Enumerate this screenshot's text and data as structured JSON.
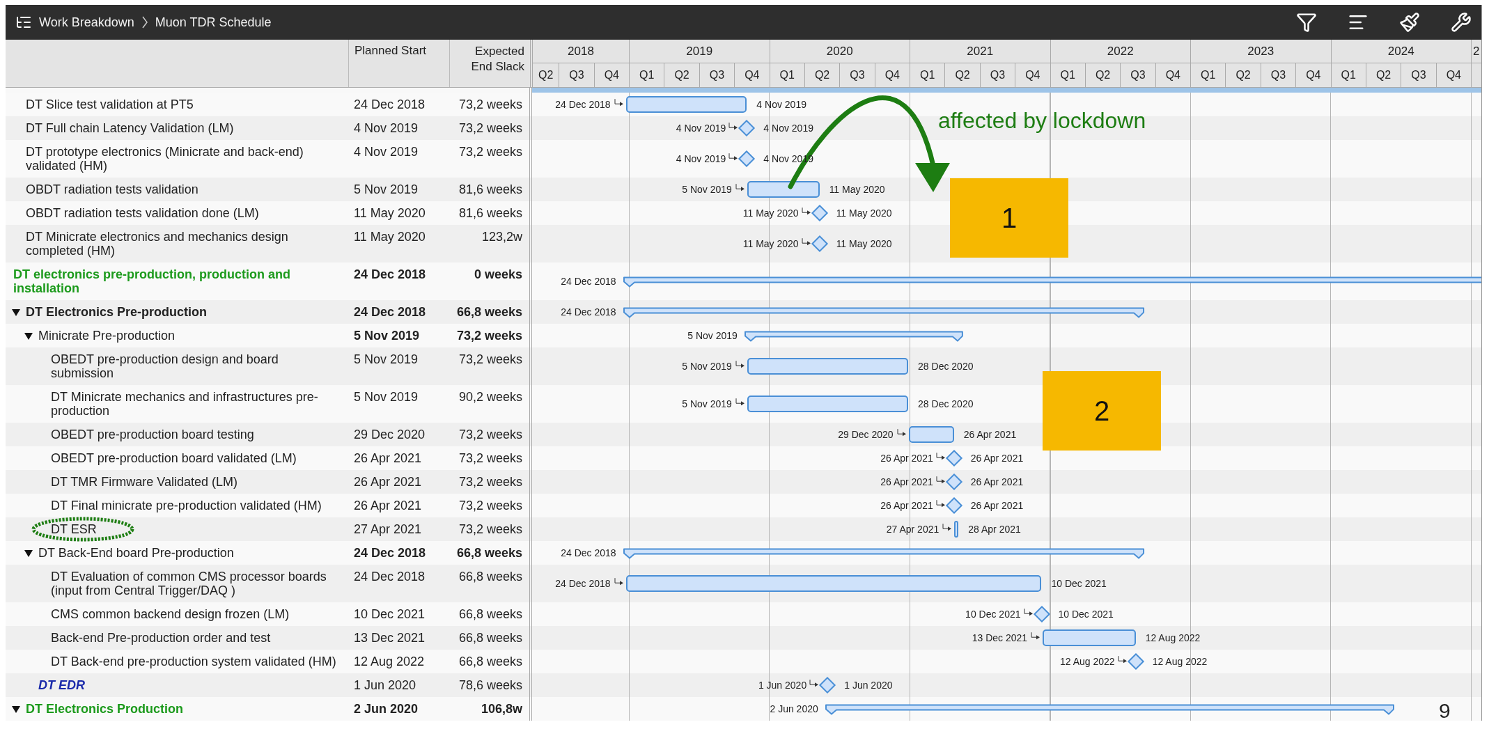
{
  "toolbar": {
    "breadcrumb": [
      "Work Breakdown",
      "Muon TDR Schedule"
    ]
  },
  "columns": {
    "planned_start": "Planned Start",
    "slack": "Expected End Slack"
  },
  "timeline": {
    "years": [
      {
        "label": "2018",
        "quarters": [
          "Q2",
          "Q3",
          "Q4"
        ]
      },
      {
        "label": "2019",
        "quarters": [
          "Q1",
          "Q2",
          "Q3",
          "Q4"
        ]
      },
      {
        "label": "2020",
        "quarters": [
          "Q1",
          "Q2",
          "Q3",
          "Q4"
        ]
      },
      {
        "label": "2021",
        "quarters": [
          "Q1",
          "Q2",
          "Q3",
          "Q4"
        ]
      },
      {
        "label": "2022",
        "quarters": [
          "Q1",
          "Q2",
          "Q3",
          "Q4"
        ]
      },
      {
        "label": "2023",
        "quarters": [
          "Q1",
          "Q2",
          "Q3",
          "Q4"
        ]
      },
      {
        "label": "2024",
        "quarters": [
          "Q1",
          "Q2",
          "Q3",
          "Q4"
        ]
      },
      {
        "label": "2"
      }
    ]
  },
  "rows": [
    {
      "name": "DT Slice test validation at PT5",
      "kind": "task",
      "start": "24 Dec 2018",
      "slack": "73,2 weeks",
      "bar": {
        "kind": "task",
        "start": "24 Dec 2018",
        "end": "4 Nov 2019"
      }
    },
    {
      "name": "DT Full chain Latency Validation (LM)",
      "kind": "task",
      "start": "4 Nov 2019",
      "slack": "73,2 weeks",
      "bar": {
        "kind": "milestone",
        "start": "4 Nov 2019",
        "end": "4 Nov 2019"
      }
    },
    {
      "name": "DT prototype electronics (Minicrate and back-end) validated (HM)",
      "kind": "task",
      "start": "4 Nov 2019",
      "slack": "73,2 weeks",
      "bar": {
        "kind": "milestone",
        "start": "4 Nov 2019",
        "end": "4 Nov 2019"
      }
    },
    {
      "name": "OBDT radiation tests validation",
      "kind": "task",
      "start": "5 Nov 2019",
      "slack": "81,6 weeks",
      "bar": {
        "kind": "task",
        "start": "5 Nov 2019",
        "end": "11 May 2020"
      }
    },
    {
      "name": "OBDT radiation tests validation done (LM)",
      "kind": "task",
      "start": "11 May 2020",
      "slack": "81,6 weeks",
      "bar": {
        "kind": "milestone",
        "start": "11 May 2020",
        "end": "11 May 2020"
      }
    },
    {
      "name": "DT Minicrate electronics and mechanics design completed (HM)",
      "kind": "task",
      "start": "11 May 2020",
      "slack": "123,2w",
      "bar": {
        "kind": "milestone",
        "start": "11 May 2020",
        "end": "11 May 2020"
      }
    },
    {
      "name": "DT electronics pre-production, production and installation",
      "kind": "summary",
      "color": "#1c9a1c",
      "start": "24 Dec 2018",
      "slack": "0 weeks",
      "bar": {
        "kind": "summary",
        "start": "24 Dec 2018"
      }
    },
    {
      "name": "DT Electronics Pre-production",
      "kind": "summary",
      "expanded": true,
      "start": "24 Dec 2018",
      "slack": "66,8 weeks",
      "bar": {
        "kind": "summary",
        "start": "24 Dec 2018"
      },
      "children": [
        {
          "name": "Minicrate Pre-production",
          "kind": "summary",
          "expanded": true,
          "start": "5 Nov 2019",
          "slack": "73,2 weeks",
          "bar": {
            "kind": "summary",
            "start": "5 Nov 2019"
          },
          "children": [
            {
              "name": "OBEDT pre-production design and board submission",
              "kind": "task",
              "start": "5 Nov 2019",
              "slack": "73,2 weeks",
              "bar": {
                "kind": "task",
                "start": "5 Nov 2019",
                "end": "28 Dec 2020"
              }
            },
            {
              "name": "DT Minicrate mechanics and infrastructures pre-production",
              "kind": "task",
              "start": "5 Nov 2019",
              "slack": "90,2 weeks",
              "bar": {
                "kind": "task",
                "start": "5 Nov 2019",
                "end": "28 Dec 2020"
              }
            },
            {
              "name": "OBEDT pre-production board testing",
              "kind": "task",
              "start": "29 Dec 2020",
              "slack": "73,2 weeks",
              "bar": {
                "kind": "task",
                "start": "29 Dec 2020",
                "end": "26 Apr 2021"
              }
            },
            {
              "name": "OBEDT pre-production board validated (LM)",
              "kind": "task",
              "start": "26 Apr 2021",
              "slack": "73,2 weeks",
              "bar": {
                "kind": "milestone",
                "start": "26 Apr 2021",
                "end": "26 Apr 2021"
              }
            },
            {
              "name": "DT TMR Firmware Validated (LM)",
              "kind": "task",
              "start": "26 Apr 2021",
              "slack": "73,2 weeks",
              "bar": {
                "kind": "milestone",
                "start": "26 Apr 2021",
                "end": "26 Apr 2021"
              }
            },
            {
              "name": "DT Final minicrate pre-production validated (HM)",
              "kind": "task",
              "start": "26 Apr 2021",
              "slack": "73,2 weeks",
              "bar": {
                "kind": "milestone",
                "start": "26 Apr 2021",
                "end": "26 Apr 2021"
              }
            },
            {
              "name": "DT ESR",
              "kind": "task",
              "start": "27 Apr 2021",
              "slack": "73,2 weeks",
              "bar": {
                "kind": "task",
                "start": "27 Apr 2021",
                "end": "28 Apr 2021"
              }
            }
          ]
        },
        {
          "name": "DT Back-End board Pre-production",
          "kind": "summary",
          "expanded": true,
          "start": "24 Dec 2018",
          "slack": "66,8 weeks",
          "bar": {
            "kind": "summary",
            "start": "24 Dec 2018"
          },
          "children": [
            {
              "name": "DT Evaluation of common CMS processor boards (input from Central Trigger/DAQ )",
              "kind": "task",
              "start": "24 Dec 2018",
              "slack": "66,8 weeks",
              "bar": {
                "kind": "task",
                "start": "24 Dec 2018",
                "end": "10 Dec 2021"
              }
            },
            {
              "name": "CMS common backend design frozen (LM)",
              "kind": "task",
              "start": "10 Dec 2021",
              "slack": "66,8 weeks",
              "bar": {
                "kind": "milestone",
                "start": "10 Dec 2021",
                "end": "10 Dec 2021"
              }
            },
            {
              "name": "Back-end Pre-production order and test",
              "kind": "task",
              "start": "13 Dec 2021",
              "slack": "66,8 weeks",
              "bar": {
                "kind": "task",
                "start": "13 Dec 2021",
                "end": "12 Aug 2022"
              }
            },
            {
              "name": "DT Back-end pre-production system validated (HM)",
              "kind": "task",
              "start": "12 Aug 2022",
              "slack": "66,8 weeks",
              "bar": {
                "kind": "milestone",
                "start": "12 Aug 2022",
                "end": "12 Aug 2022"
              }
            }
          ]
        },
        {
          "name": "DT EDR",
          "kind": "external",
          "color": "#1a2aaa",
          "start": "1 Jun 2020",
          "slack": "78,6 weeks",
          "bar": {
            "kind": "milestone",
            "start": "1 Jun 2020",
            "end": "1 Jun 2020"
          }
        }
      ]
    },
    {
      "name": "DT Electronics Production",
      "kind": "summary",
      "color": "#1c9a1c",
      "expanded": true,
      "start": "2 Jun 2020",
      "slack": "106,8w",
      "bar": {
        "kind": "summary",
        "start": "2 Jun 2020"
      }
    }
  ],
  "annotations": {
    "note": "affected by lockdown",
    "boxes": [
      "1",
      "2"
    ]
  },
  "page_number": "9"
}
